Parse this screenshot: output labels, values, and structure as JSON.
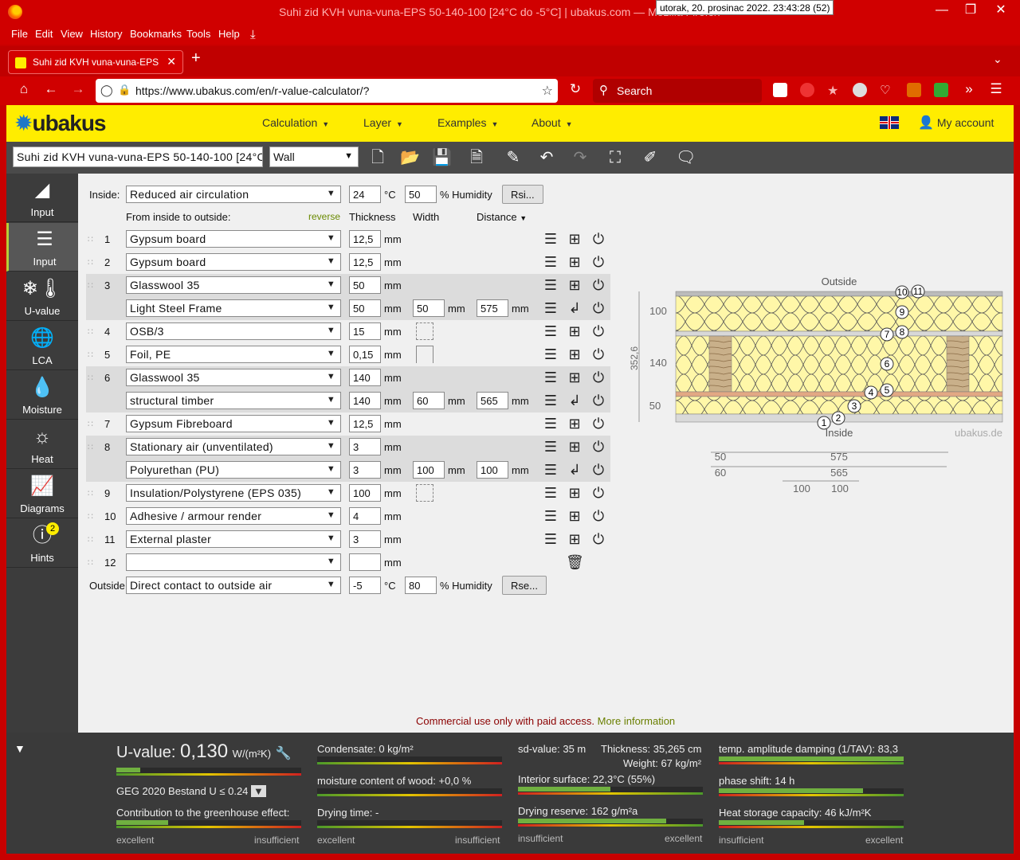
{
  "browser": {
    "window_title": "Suhi zid KVH vuna-vuna-EPS 50-140-100 [24°C do -5°C] | ubakus.com — Mozilla Firefox",
    "clock": "utorak, 20. prosinac 2022. 23:43:28 (52)",
    "menu": [
      "File",
      "Edit",
      "View",
      "History",
      "Bookmarks",
      "Tools",
      "Help"
    ],
    "tab_title": "Suhi zid KVH vuna-vuna-EPS 50-140-100 [24°C do -5°C] | ubakus.com",
    "url": "https://www.ubakus.com/en/r-value-calculator/?",
    "search_placeholder": "Search"
  },
  "header": {
    "logo": "ubakus",
    "menu": [
      "Calculation",
      "Layer",
      "Examples",
      "About"
    ],
    "account": "My account"
  },
  "toolbar": {
    "project_name": "Suhi zid KVH vuna-vuna-EPS 50-140-100 [24°C do -5°C]",
    "component_type": "Wall"
  },
  "sidebar": [
    {
      "label": "Input",
      "icon": "ruler-triangle-icon"
    },
    {
      "label": "Input",
      "icon": "layers-edit-icon",
      "active": true
    },
    {
      "label": "U-value",
      "icon": "thermometer-snow-icon"
    },
    {
      "label": "LCA",
      "icon": "globe-icon"
    },
    {
      "label": "Moisture",
      "icon": "drop-icon"
    },
    {
      "label": "Heat",
      "icon": "sun-icon"
    },
    {
      "label": "Diagrams",
      "icon": "chart-icon"
    },
    {
      "label": "Hints",
      "icon": "exclamation-icon",
      "badge": "2"
    }
  ],
  "inside": {
    "label": "Inside:",
    "condition": "Reduced air circulation",
    "temp": "24",
    "temp_unit": "°C",
    "humidity": "50",
    "humidity_unit": "% Humidity",
    "button": "Rsi..."
  },
  "columns": {
    "from": "From inside to outside:",
    "reverse": "reverse",
    "thickness": "Thickness",
    "width": "Width",
    "distance": "Distance"
  },
  "layers": [
    {
      "n": "1",
      "material": "Gypsum board",
      "thickness": "12,5"
    },
    {
      "n": "2",
      "material": "Gypsum board",
      "thickness": "12,5"
    },
    {
      "n": "3",
      "material": "Glasswool 35",
      "thickness": "50",
      "sub": {
        "material": "Light Steel Frame",
        "thickness": "50",
        "width": "50",
        "distance": "575"
      }
    },
    {
      "n": "4",
      "material": "OSB/3",
      "thickness": "15"
    },
    {
      "n": "5",
      "material": "Foil, PE",
      "thickness": "0,15"
    },
    {
      "n": "6",
      "material": "Glasswool 35",
      "thickness": "140",
      "sub": {
        "material": "structural timber",
        "thickness": "140",
        "width": "60",
        "distance": "565"
      }
    },
    {
      "n": "7",
      "material": "Gypsum Fibreboard",
      "thickness": "12,5"
    },
    {
      "n": "8",
      "material": "Stationary air (unventilated)",
      "thickness": "3",
      "sub": {
        "material": "Polyurethan (PU)",
        "thickness": "3",
        "width": "100",
        "distance": "100"
      }
    },
    {
      "n": "9",
      "material": "Insulation/Polystyrene (EPS 035)",
      "thickness": "100"
    },
    {
      "n": "10",
      "material": "Adhesive / armour render",
      "thickness": "4"
    },
    {
      "n": "11",
      "material": "External plaster",
      "thickness": "3"
    },
    {
      "n": "12",
      "material": "",
      "thickness": ""
    }
  ],
  "unit_mm": "mm",
  "outside": {
    "label": "Outside",
    "condition": "Direct contact to outside air",
    "temp": "-5",
    "temp_unit": "°C",
    "humidity": "80",
    "humidity_unit": "% Humidity",
    "button": "Rse..."
  },
  "diagram": {
    "outside_label": "Outside",
    "inside_label": "Inside",
    "watermark": "ubakus.de",
    "total": "352,6",
    "dims_left": [
      "100",
      "140",
      "50"
    ],
    "dims_bottom": {
      "a": "50",
      "b": "575",
      "c": "60",
      "d": "565",
      "e": "100",
      "f": "100"
    },
    "markers": [
      "1",
      "2",
      "3",
      "4",
      "5",
      "6",
      "7",
      "8",
      "9",
      "10",
      "11"
    ]
  },
  "notice": {
    "text": "Commercial use only with paid access.",
    "link": "More information"
  },
  "results": {
    "uvalue_label": "U-value:",
    "uvalue": "0,130",
    "uvalue_unit": "W/(m²K)",
    "uvalue_bar": 0.13,
    "standard": "GEG 2020 Bestand U ≤ 0.24",
    "greenhouse": "Contribution to the greenhouse effect:",
    "greenhouse_bar": 0.28,
    "condensate": "Condensate: 0 kg/m²",
    "condensate_bar": 0.0,
    "moisture_wood": "moisture content of wood: +0,0 %",
    "moisture_bar": 0.0,
    "drying_time": "Drying time: -",
    "drying_time_bar": 0.0,
    "sd_value": "sd-value: 35 m",
    "thickness": "Thickness: 35,265 cm",
    "weight": "Weight: 67 kg/m²",
    "interior_surface": "Interior surface: 22,3°C (55%)",
    "interior_bar": 0.5,
    "drying_reserve": "Drying reserve: 162 g/m²a",
    "drying_reserve_bar": 0.8,
    "amplitude": "temp. amplitude damping (1/TAV): 83,3",
    "amplitude_bar": 1.0,
    "phase_shift": "phase shift: 14 h",
    "phase_bar": 0.78,
    "heat_storage": "Heat storage capacity: 46 kJ/m²K",
    "heat_bar": 0.46,
    "scale_excellent": "excellent",
    "scale_insufficient": "insufficient"
  }
}
